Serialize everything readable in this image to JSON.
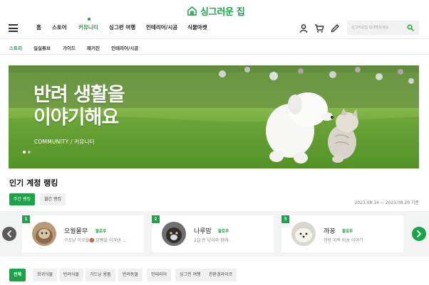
{
  "brand": {
    "name": "싱그러운 집",
    "accent_color": "#1ba34a"
  },
  "nav": {
    "menu_icon": "hamburger-menu-icon",
    "items": [
      {
        "label": "홈"
      },
      {
        "label": "스토어"
      },
      {
        "label": "커뮤니티",
        "active": true
      },
      {
        "label": "싱그런 여행"
      },
      {
        "label": "인테리어/시공"
      },
      {
        "label": "식물마켓"
      }
    ],
    "icons": [
      "user-icon",
      "cart-icon",
      "pencil-icon"
    ],
    "search": {
      "placeholder": "싱그러운집 검색해보세요.",
      "icon": "search-icon"
    }
  },
  "subnav": {
    "items": [
      {
        "label": "스토리",
        "active": true
      },
      {
        "label": "실실튜브"
      },
      {
        "label": "가이드"
      },
      {
        "label": "매거진"
      },
      {
        "label": "인테리어/시공"
      }
    ]
  },
  "banner": {
    "title_line1": "반려 생활을",
    "title_line2": "이야기해요",
    "subtitle": "COMMUNITY / 커뮤니티",
    "slides": 2,
    "active_slide": 1
  },
  "ranking": {
    "title": "인기 계정 랭킹",
    "tabs": [
      {
        "label": "주간 랭킹",
        "active": true
      },
      {
        "label": "월간 랭킹"
      }
    ],
    "date_range": "2023.08.14 ~ 2023.08.20 기준",
    "follow_label": "팔로우",
    "cards": [
      {
        "rank": "1",
        "name": "오월물무",
        "desc": "구조냥 이오월🟤 밤뻥을 이겨낸 ..."
      },
      {
        "rank": "2",
        "name": "나루맘",
        "desc": "2살 만 냥이와 함께-"
      },
      {
        "rank": "3",
        "name": "까꿍",
        "desc": "천방 지축 비숑 이야기"
      }
    ]
  },
  "categories": [
    {
      "label": "전체",
      "active": true
    },
    {
      "label": "희귀식물"
    },
    {
      "label": "반려식물"
    },
    {
      "label": "가드닝 용품"
    },
    {
      "label": "반려동물"
    },
    {
      "label": "인테리어"
    },
    {
      "label": "싱그런 여행"
    },
    {
      "label": "친환경라이프"
    }
  ]
}
